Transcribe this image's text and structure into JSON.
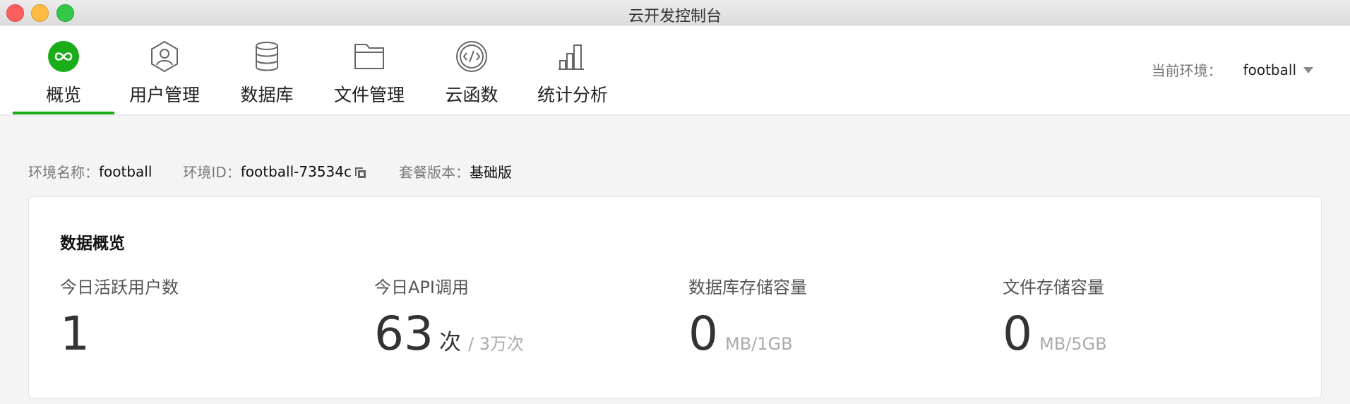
{
  "window": {
    "title": "云开发控制台"
  },
  "nav": {
    "items": [
      {
        "label": "概览",
        "icon": "overview-infinity-icon",
        "active": true
      },
      {
        "label": "用户管理",
        "icon": "user-icon"
      },
      {
        "label": "数据库",
        "icon": "database-icon"
      },
      {
        "label": "文件管理",
        "icon": "folder-icon"
      },
      {
        "label": "云函数",
        "icon": "code-icon"
      },
      {
        "label": "统计分析",
        "icon": "bar-chart-icon"
      }
    ],
    "accent_color": "#1aad19"
  },
  "env_select": {
    "label": "当前环境：",
    "value": "football"
  },
  "info": {
    "name_label": "环境名称：",
    "name_value": "football",
    "id_label": "环境ID：",
    "id_value": "football-73534c",
    "plan_label": "套餐版本：",
    "plan_value": "基础版"
  },
  "overview": {
    "title": "数据概览",
    "stats": [
      {
        "label": "今日活跃用户数",
        "value": "1",
        "unit": "",
        "quota": ""
      },
      {
        "label": "今日API调用",
        "value": "63",
        "unit": "次",
        "quota": "/ 3万次"
      },
      {
        "label": "数据库存储容量",
        "value": "0",
        "unit": "",
        "quota": "MB/1GB"
      },
      {
        "label": "文件存储容量",
        "value": "0",
        "unit": "",
        "quota": "MB/5GB"
      }
    ]
  }
}
